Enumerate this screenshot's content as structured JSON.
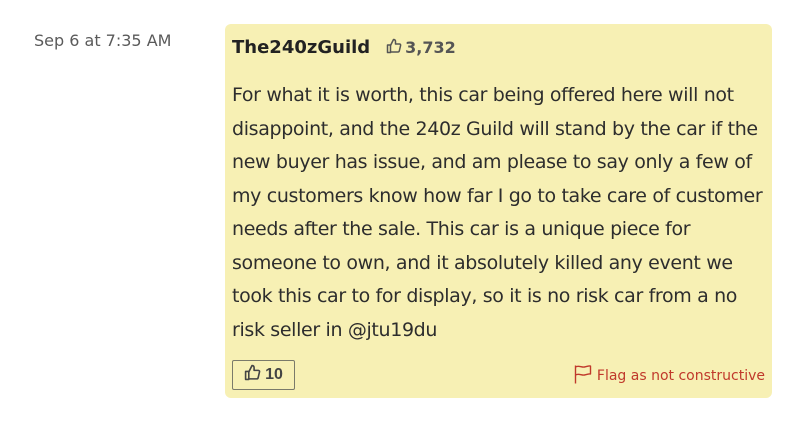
{
  "comment": {
    "timestamp": "Sep 6 at 7:35 AM",
    "author": {
      "username": "The240zGuild",
      "reputation": "3,732",
      "reputation_icon": "thumbs-up-icon"
    },
    "body": "For what it is worth, this car being offered here will not disappoint, and the 240z Guild will stand by the car if the new buyer has issue, and am please to say only a few of my customers know how far I go to take care of customer needs after the sale. This car is a unique piece for someone to own, and it absolutely killed any event we took this car to for display, so it is no risk car from a no risk seller in @jtu19du",
    "like_count": "10",
    "like_icon": "thumbs-up-icon",
    "flag_label": "Flag as not constructive",
    "flag_icon": "flag-icon"
  },
  "colors": {
    "bubble_background": "#f7f0b4",
    "flag_red": "#c0392b",
    "text": "#2d2d2d"
  }
}
